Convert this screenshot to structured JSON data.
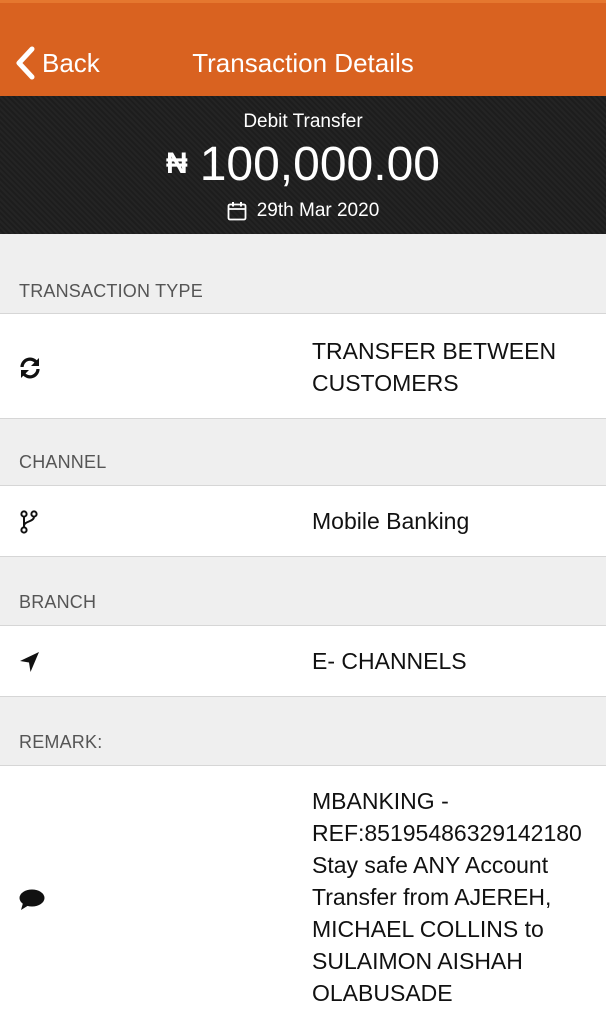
{
  "header": {
    "back_label": "Back",
    "title": "Transaction Details",
    "color": "#d96220"
  },
  "summary": {
    "kind": "Debit Transfer",
    "currency_symbol": "₦",
    "amount": "100,000.00",
    "date": "29th Mar 2020"
  },
  "sections": {
    "type": {
      "label": "TRANSACTION TYPE",
      "icon": "refresh-icon",
      "value": "TRANSFER BETWEEN CUSTOMERS"
    },
    "channel": {
      "label": "CHANNEL",
      "icon": "branch-icon",
      "value": "Mobile Banking"
    },
    "branch": {
      "label": "BRANCH",
      "icon": "location-arrow-icon",
      "value": "E- CHANNELS"
    },
    "remark": {
      "label": "REMARK:",
      "icon": "comment-icon",
      "lines": [
        "MBANKING -",
        "REF:85195486329142180",
        "Stay safe ANY Account",
        "Transfer from AJEREH,",
        "MICHAEL COLLINS to",
        "SULAIMON AISHAH",
        "OLABUSADE"
      ]
    }
  }
}
